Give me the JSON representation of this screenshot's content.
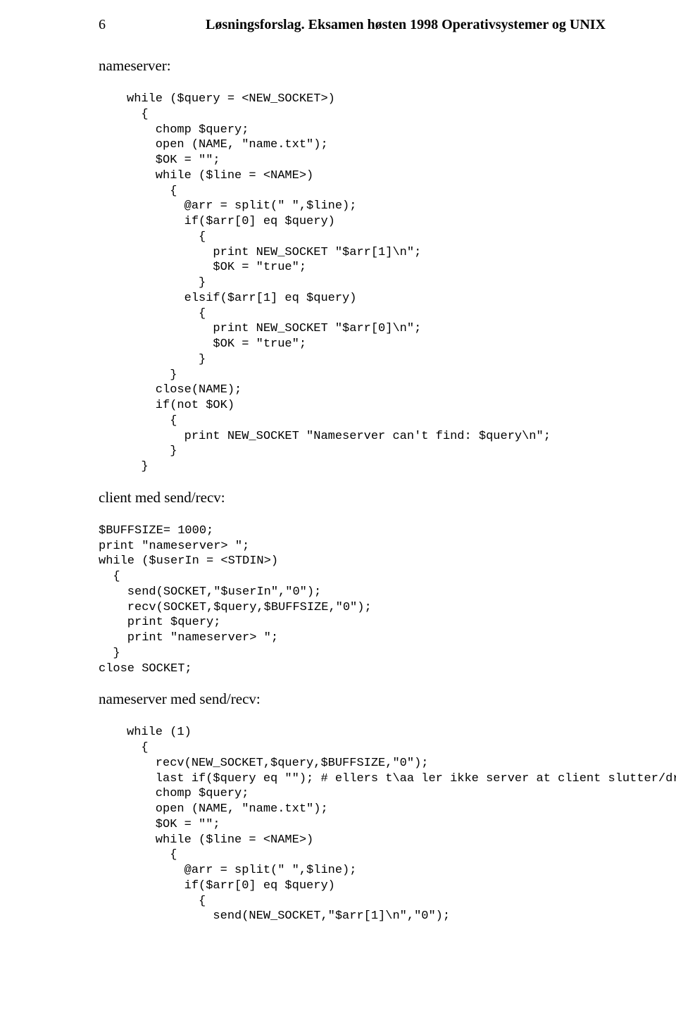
{
  "header": {
    "page_number": "6",
    "title": "Løsningsforslag. Eksamen høsten 1998 Operativsystemer og UNIX"
  },
  "sections": {
    "label1": "nameserver:",
    "code1": "while ($query = <NEW_SOCKET>)\n  {\n    chomp $query;\n    open (NAME, \"name.txt\");\n    $OK = \"\";\n    while ($line = <NAME>)\n      {\n        @arr = split(\" \",$line);\n        if($arr[0] eq $query)\n          {\n            print NEW_SOCKET \"$arr[1]\\n\";\n            $OK = \"true\";\n          }\n        elsif($arr[1] eq $query)\n          {\n            print NEW_SOCKET \"$arr[0]\\n\";\n            $OK = \"true\";\n          }\n      }\n    close(NAME);\n    if(not $OK)\n      {\n        print NEW_SOCKET \"Nameserver can't find: $query\\n\";\n      }\n  }",
    "label2": "client med send/recv:",
    "code2": "$BUFFSIZE= 1000;\nprint \"nameserver> \";\nwhile ($userIn = <STDIN>)\n  {\n    send(SOCKET,\"$userIn\",\"0\");\n    recv(SOCKET,$query,$BUFFSIZE,\"0\");\n    print $query;\n    print \"nameserver> \";\n  }\nclose SOCKET;",
    "label3": "nameserver med send/recv:",
    "code3": "while (1)\n  {\n    recv(NEW_SOCKET,$query,$BUFFSIZE,\"0\");\n    last if($query eq \"\"); # ellers t\\aa ler ikke server at client slutter/drepes\n    chomp $query;\n    open (NAME, \"name.txt\");\n    $OK = \"\";\n    while ($line = <NAME>)\n      {\n        @arr = split(\" \",$line);\n        if($arr[0] eq $query)\n          {\n            send(NEW_SOCKET,\"$arr[1]\\n\",\"0\");"
  }
}
